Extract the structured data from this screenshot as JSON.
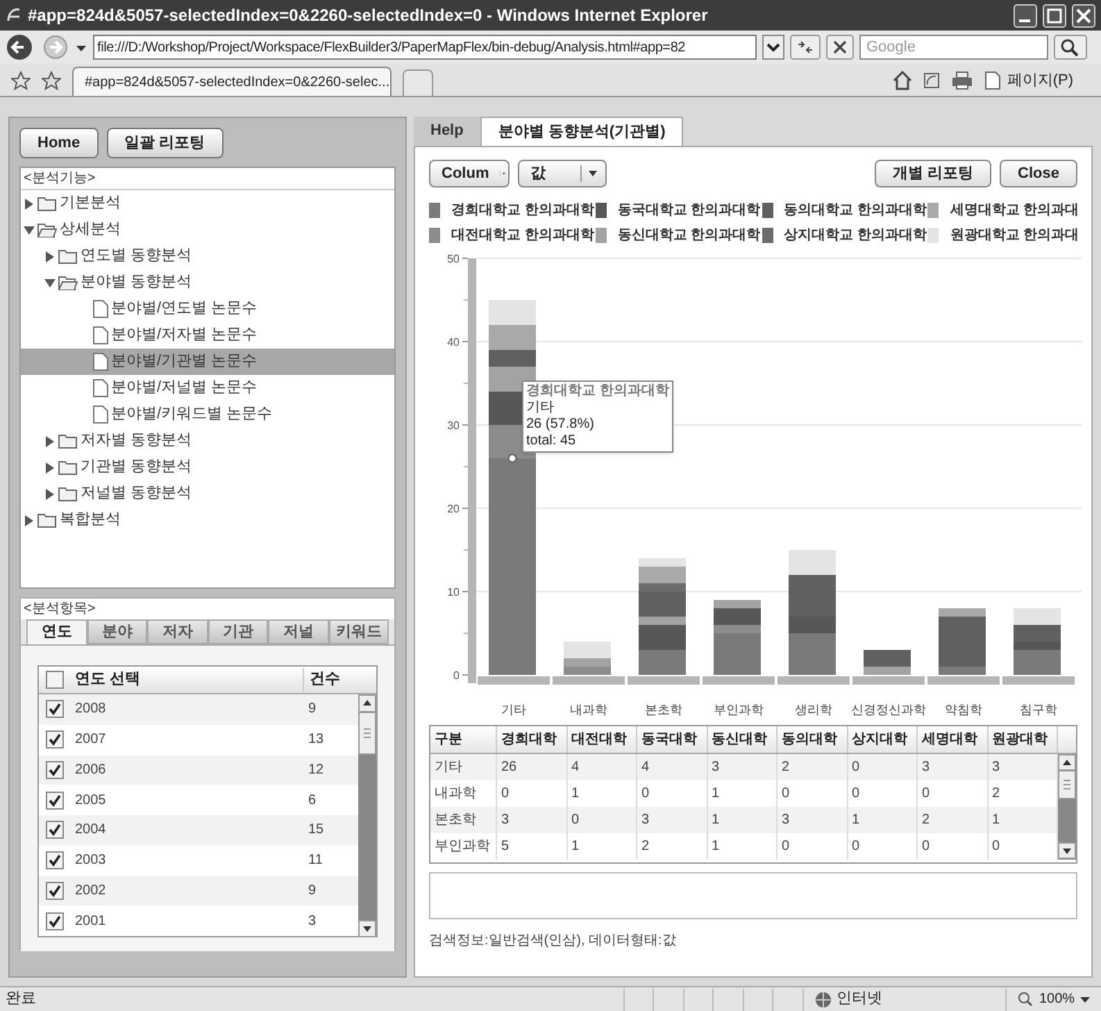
{
  "window": {
    "title": "#app=824d&5057-selectedIndex=0&2260-selectedIndex=0 - Windows Internet Explorer"
  },
  "address_bar": {
    "value": "file:///D:/Workshop/Project/Workspace/FlexBuilder3/PaperMapFlex/bin-debug/Analysis.html#app=82"
  },
  "search": {
    "placeholder": "Google"
  },
  "browser_tabs": [
    {
      "label": "#app=824d&5057-selectedIndex=0&2260-selec...",
      "selected": true
    }
  ],
  "command_bar": {
    "page_menu": "페이지(P)"
  },
  "left_panel": {
    "buttons": [
      "Home",
      "일괄 리포팅"
    ],
    "tree_title": "<분석기능>",
    "tree": [
      {
        "label": "기본분석",
        "kind": "folder",
        "expanded": false,
        "selected": false
      },
      {
        "label": "상세분석",
        "kind": "folder",
        "expanded": true,
        "selected": false,
        "children": [
          {
            "label": "연도별 동향분석",
            "kind": "folder",
            "expanded": false,
            "selected": false
          },
          {
            "label": "분야별 동향분석",
            "kind": "folder",
            "expanded": true,
            "selected": false,
            "children": [
              {
                "label": "분야별/연도별 논문수",
                "kind": "file",
                "selected": false
              },
              {
                "label": "분야별/저자별 논문수",
                "kind": "file",
                "selected": false
              },
              {
                "label": "분야별/기관별 논문수",
                "kind": "file",
                "selected": true
              },
              {
                "label": "분야별/저널별 논문수",
                "kind": "file",
                "selected": false
              },
              {
                "label": "분야별/키워드별 논문수",
                "kind": "file",
                "selected": false
              }
            ]
          },
          {
            "label": "저자별 동향분석",
            "kind": "folder",
            "expanded": false,
            "selected": false
          },
          {
            "label": "기관별 동향분석",
            "kind": "folder",
            "expanded": false,
            "selected": false
          },
          {
            "label": "저널별 동향분석",
            "kind": "folder",
            "expanded": false,
            "selected": false
          }
        ]
      },
      {
        "label": "복합분석",
        "kind": "folder",
        "expanded": false,
        "selected": false
      }
    ],
    "items_title": "<분석항목>",
    "tabs": [
      {
        "label": "연도",
        "selected": true
      },
      {
        "label": "분야",
        "selected": false
      },
      {
        "label": "저자",
        "selected": false
      },
      {
        "label": "기관",
        "selected": false
      },
      {
        "label": "저널",
        "selected": false
      },
      {
        "label": "키워드",
        "selected": false
      }
    ],
    "grid": {
      "columns": [
        "연도 선택",
        "건수"
      ],
      "header_checked": false,
      "rows": [
        {
          "label": "2008",
          "count": "9",
          "checked": true
        },
        {
          "label": "2007",
          "count": "13",
          "checked": true
        },
        {
          "label": "2006",
          "count": "12",
          "checked": true
        },
        {
          "label": "2005",
          "count": "6",
          "checked": true
        },
        {
          "label": "2004",
          "count": "15",
          "checked": true
        },
        {
          "label": "2003",
          "count": "11",
          "checked": true
        },
        {
          "label": "2002",
          "count": "9",
          "checked": true
        },
        {
          "label": "2001",
          "count": "3",
          "checked": true
        }
      ]
    }
  },
  "right_panel": {
    "tabs": [
      {
        "label": "Help",
        "selected": false
      },
      {
        "label": "분야별 동향분석(기관별)",
        "selected": true
      }
    ],
    "chart_type": "Colum",
    "value_type": "값",
    "buttons": [
      "개별 리포팅",
      "Close"
    ],
    "chart_data": {
      "type": "bar",
      "stacked": true,
      "orientation": "vertical",
      "grid": true,
      "categories": [
        "기타",
        "내과학",
        "본초학",
        "부인과학",
        "생리학",
        "신경정신과학",
        "약침학",
        "침구학"
      ],
      "ylim": [
        0,
        50
      ],
      "yticks": [
        0,
        10,
        20,
        30,
        40,
        50
      ],
      "series": [
        {
          "name": "경희대학교 한의과대학",
          "color": "#7a7a7a",
          "values": [
            26,
            0,
            3,
            5,
            5,
            0,
            1,
            3
          ]
        },
        {
          "name": "대전대학교 한의과대학",
          "color": "#8c8c8c",
          "values": [
            4,
            1,
            0,
            1,
            0,
            0,
            0,
            0
          ]
        },
        {
          "name": "동국대학교 한의과대학",
          "color": "#575757",
          "values": [
            4,
            0,
            3,
            2,
            2,
            0,
            0,
            1
          ]
        },
        {
          "name": "동신대학교 한의과대학",
          "color": "#a3a3a3",
          "values": [
            3,
            1,
            1,
            1,
            0,
            1,
            0,
            0
          ]
        },
        {
          "name": "동의대학교 한의과대학",
          "color": "#606060",
          "values": [
            2,
            0,
            3,
            0,
            5,
            2,
            6,
            2
          ]
        },
        {
          "name": "상지대학교 한의과대학",
          "color": "#6c6c6c",
          "values": [
            0,
            0,
            1,
            0,
            0,
            0,
            0,
            0
          ]
        },
        {
          "name": "세명대학교 한의과대",
          "color": "#a9a9a9",
          "values": [
            3,
            0,
            2,
            0,
            0,
            0,
            1,
            0
          ]
        },
        {
          "name": "원광대학교 한의과대",
          "color": "#e4e4e4",
          "values": [
            3,
            2,
            1,
            0,
            3,
            0,
            0,
            2
          ]
        }
      ]
    },
    "tooltip": {
      "lines": [
        "경희대학교 한의과대학",
        "기타",
        "26 (57.8%)",
        "total: 45"
      ]
    },
    "table": {
      "columns": [
        "구분",
        "경희대학",
        "대전대학",
        "동국대학",
        "동신대학",
        "동의대학",
        "상지대학",
        "세명대학",
        "원광대학"
      ],
      "rows": [
        [
          "기타",
          "26",
          "4",
          "4",
          "3",
          "2",
          "0",
          "3",
          "3"
        ],
        [
          "내과학",
          "0",
          "1",
          "0",
          "1",
          "0",
          "0",
          "0",
          "2"
        ],
        [
          "본초학",
          "3",
          "0",
          "3",
          "1",
          "3",
          "1",
          "2",
          "1"
        ],
        [
          "부인과학",
          "5",
          "1",
          "2",
          "1",
          "0",
          "0",
          "0",
          "0"
        ]
      ]
    },
    "search_info": "검색정보:일반검색(인삼), 데이터형태:값"
  },
  "status_bar": {
    "text": "완료",
    "zone": "인터넷",
    "zoom": "100%"
  }
}
